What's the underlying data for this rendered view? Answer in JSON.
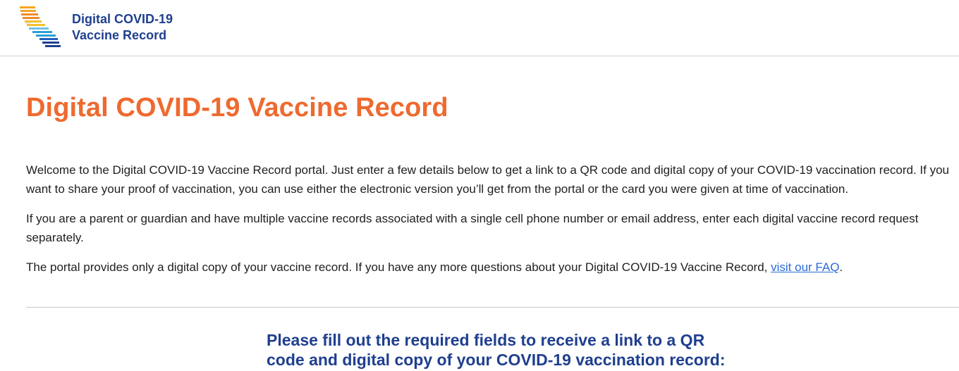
{
  "header": {
    "logo_line1": "Digital COVID-19",
    "logo_line2": "Vaccine Record",
    "logo_icon": "california-state-logo-icon",
    "colors": {
      "stripes": [
        "#f5a623",
        "#f08a2a",
        "#f2c12e",
        "#6fc1e6",
        "#2a9fd8",
        "#1f5fbf",
        "#1f3f8f"
      ]
    }
  },
  "main": {
    "title": "Digital COVID-19 Vaccine Record",
    "title_color": "#ee6a2f",
    "paragraph1": "Welcome to the Digital COVID-19 Vaccine Record portal. Just enter a few details below to get a link to a QR code and digital copy of your COVID-19 vaccination record. If you want to share your proof of vaccination, you can use either the electronic version you’ll get from the portal or the card you were given at time of vaccination.",
    "paragraph2": "If you are a parent or guardian and have multiple vaccine records associated with a single cell phone number or email address, enter each digital vaccine record request separately.",
    "paragraph3_before": "The portal provides only a digital copy of your vaccine record. If you have any more questions about your Digital COVID-19 Vaccine Record, ",
    "paragraph3_link": "visit our FAQ",
    "paragraph3_after": ".",
    "link_color": "#2a6ad8"
  },
  "form": {
    "heading": "Please fill out the required fields to receive a link to a QR code and digital copy of your COVID-19 vaccination record:",
    "heading_color": "#1f3f8f"
  }
}
